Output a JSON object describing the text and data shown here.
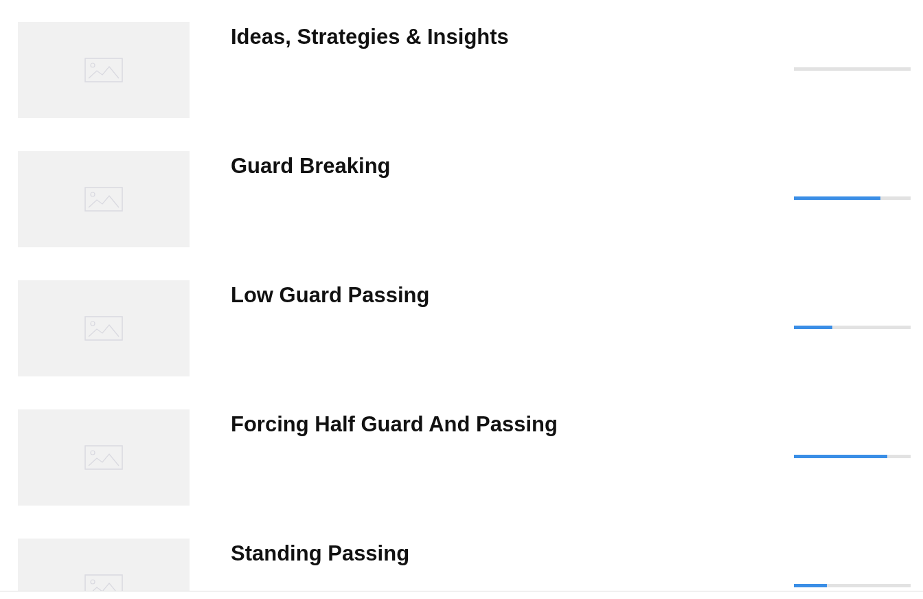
{
  "courses": [
    {
      "title": "Ideas, Strategies & Insights"
    },
    {
      "title": "Guard Breaking",
      "level": 0.74
    },
    {
      "title": "Low Guard Passing",
      "level": 0.33
    },
    {
      "title": "Forcing Half Guard And Passing",
      "level": 0.8
    },
    {
      "title": "Standing Passing",
      "level": 0.28
    }
  ]
}
